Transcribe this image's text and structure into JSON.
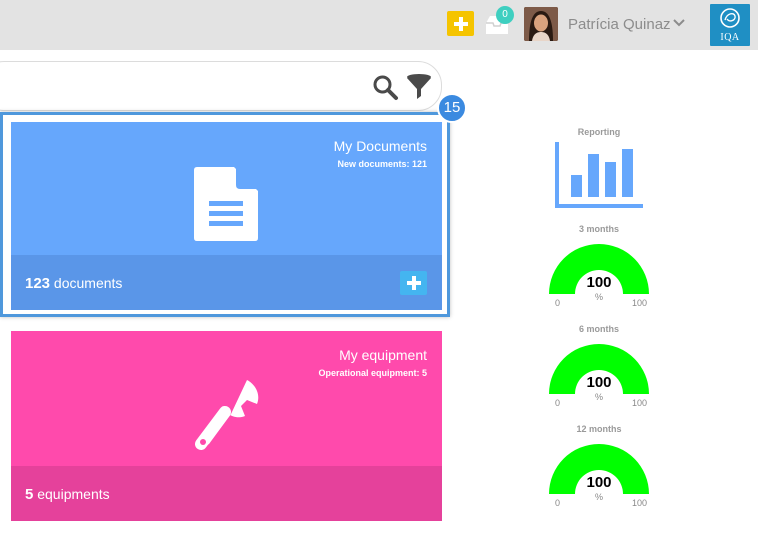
{
  "header": {
    "notifications_count": "0",
    "user_name": "Patrícia Quinaz",
    "logo_text": "IQA"
  },
  "search": {
    "badge_count": "15"
  },
  "cards": {
    "documents": {
      "title": "My Documents",
      "subtitle": "New documents: 121",
      "count": "123",
      "count_label": "documents"
    },
    "equipment": {
      "title": "My equipment",
      "subtitle": "Operational equipment: 5",
      "count": "5",
      "count_label": "equipments"
    }
  },
  "side": {
    "reporting_label": "Reporting",
    "gauges": [
      {
        "label": "3 months",
        "value": "100",
        "unit": "%",
        "min": "0",
        "max": "100"
      },
      {
        "label": "6 months",
        "value": "100",
        "unit": "%",
        "min": "0",
        "max": "100"
      },
      {
        "label": "12 months",
        "value": "100",
        "unit": "%",
        "min": "0",
        "max": "100"
      }
    ]
  },
  "colors": {
    "documents_card": "#66a7fc",
    "equipment_card": "#ff4aac",
    "gauge_fill": "#00ff00",
    "add_button": "#f5c400"
  },
  "icons": [
    "plus-icon",
    "inbox-icon",
    "chevron-down-icon",
    "search-icon",
    "filter-icon",
    "document-icon",
    "wrench-icon",
    "bar-chart-icon"
  ]
}
